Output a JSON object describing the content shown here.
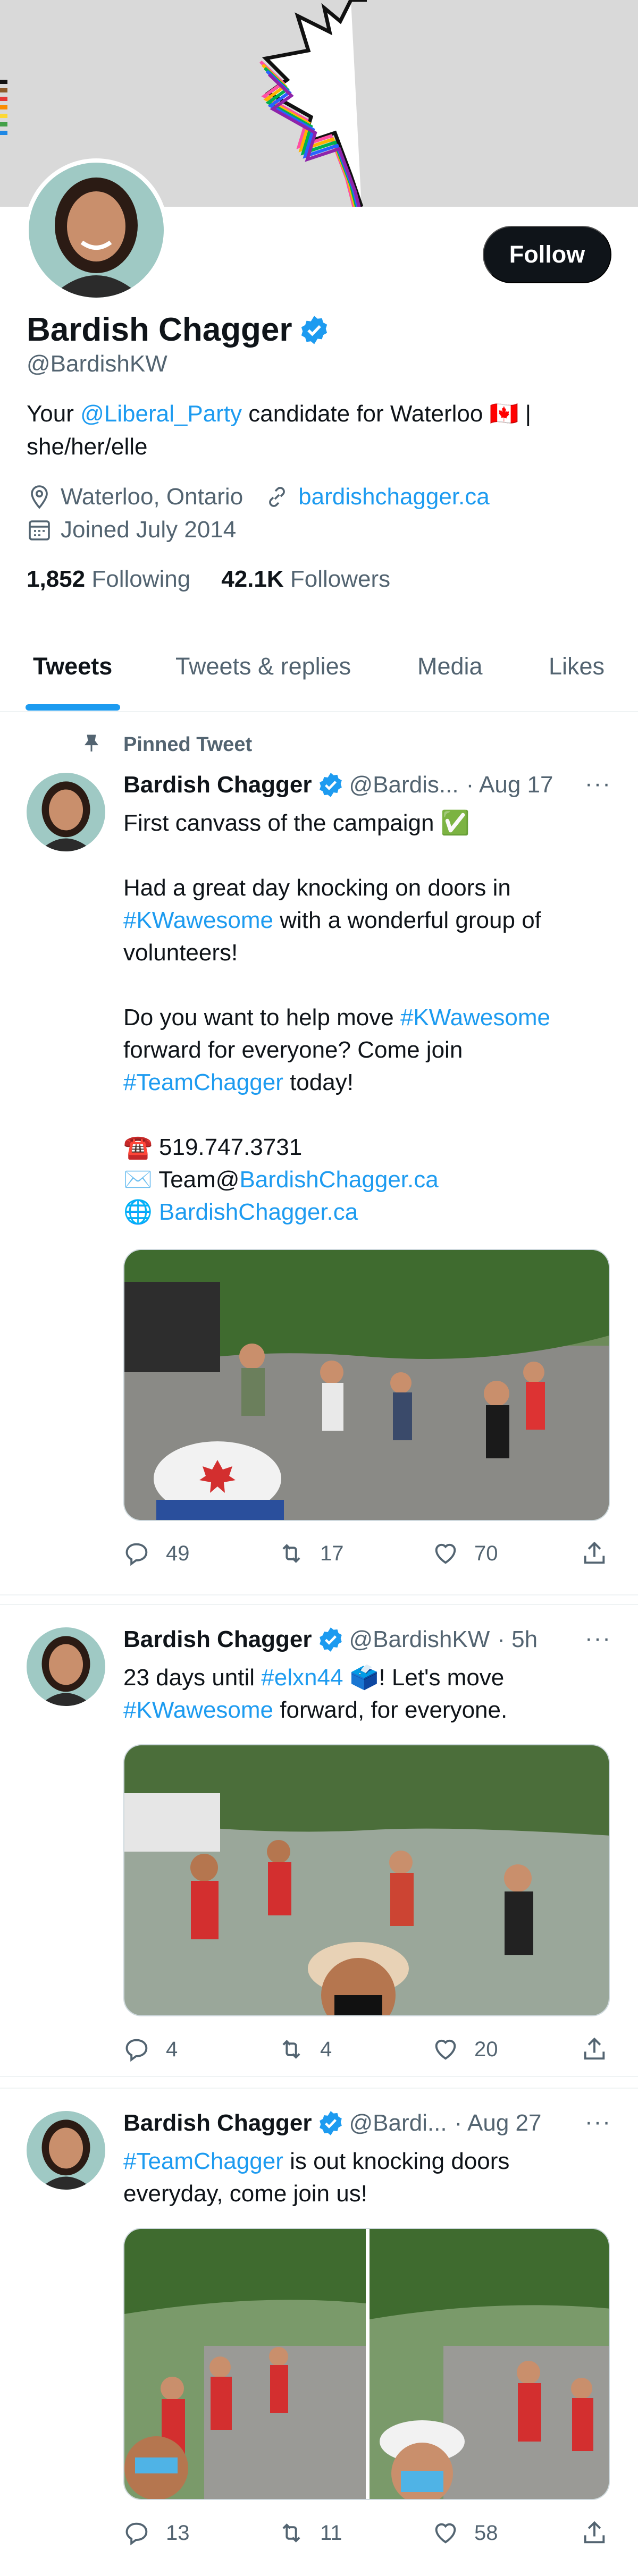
{
  "profile": {
    "name": "Bardish Chagger",
    "handle": "@BardishKW",
    "follow_label": "Follow",
    "bio_prefix": "Your ",
    "bio_mention": "@Liberal_Party",
    "bio_middle": " candidate for Waterloo 🇨🇦 |",
    "bio_line2": "she/her/elle",
    "location": "Waterloo, Ontario",
    "website": "bardishchagger.ca",
    "joined": "Joined July 2014",
    "following_count": "1,852",
    "following_label": "Following",
    "followers_count": "42.1K",
    "followers_label": "Followers"
  },
  "tabs": [
    "Tweets",
    "Tweets & replies",
    "Media",
    "Likes"
  ],
  "pinned_label": "Pinned Tweet",
  "tweets": [
    {
      "name": "Bardish Chagger",
      "handle": "@Bardis...",
      "time": "· Aug 17",
      "more": "···",
      "lines": [
        "First canvass of the campaign ✅",
        "",
        "Had a great day knocking on doors in",
        "#KWawesome with a wonderful group of",
        "volunteers!",
        "",
        "Do you want to help move #KWawesome",
        "forward for everyone? Come join",
        "#TeamChagger today!",
        "",
        "☎️ 519.747.3731",
        "✉️ Team@BardishChagger.ca",
        "🌐 BardishChagger.ca"
      ],
      "replies": "49",
      "retweets": "17",
      "likes": "70"
    },
    {
      "name": "Bardish Chagger",
      "handle": "@BardishKW",
      "time": "· 5h",
      "more": "···",
      "lines": [
        "23 days until #elxn44 🗳️! Let's move",
        "#KWawesome forward, for everyone."
      ],
      "replies": "4",
      "retweets": "4",
      "likes": "20"
    },
    {
      "name": "Bardish Chagger",
      "handle": "@Bardi...",
      "time": "· Aug 27",
      "more": "···",
      "lines": [
        "#TeamChagger is out knocking doors",
        "everyday, come join us!"
      ],
      "replies": "13",
      "retweets": "11",
      "likes": "58"
    }
  ],
  "colors": {
    "accent": "#1d9bf0",
    "text": "#0f1419",
    "muted": "#536471",
    "banner": "#d9d9d9",
    "follow_button": "#0f1419"
  },
  "icons": [
    "verified-icon",
    "location-icon",
    "link-icon",
    "calendar-icon",
    "pin-icon",
    "reply-icon",
    "retweet-icon",
    "like-icon",
    "share-icon",
    "more-icon"
  ]
}
